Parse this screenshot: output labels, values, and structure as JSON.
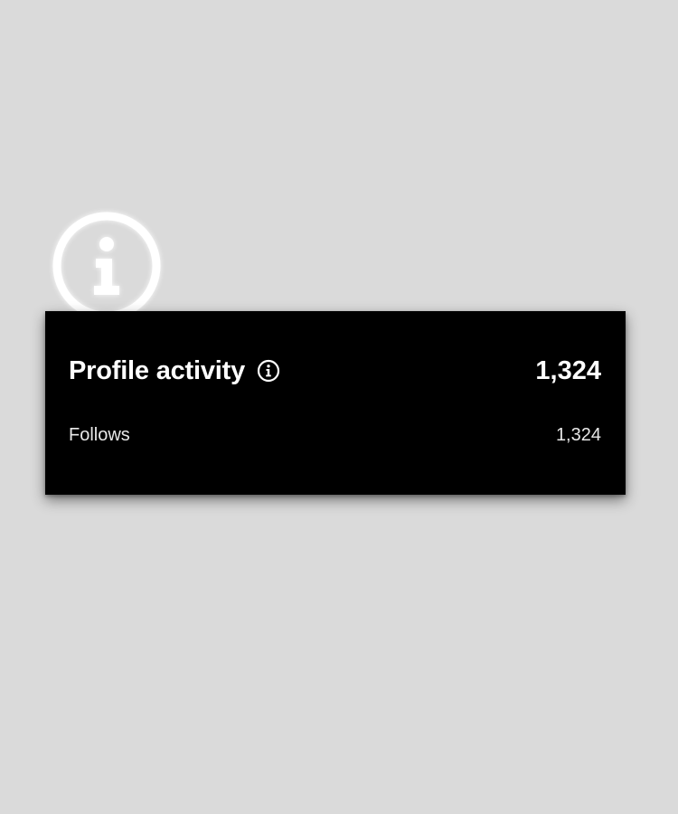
{
  "background_color": "#dadada",
  "overlay_icon": "info-icon",
  "card": {
    "title": "Profile activity",
    "title_icon": "info-icon",
    "total": "1,324",
    "rows": [
      {
        "label": "Follows",
        "value": "1,324"
      }
    ],
    "background_color": "#000000",
    "text_color": "#ffffff"
  }
}
